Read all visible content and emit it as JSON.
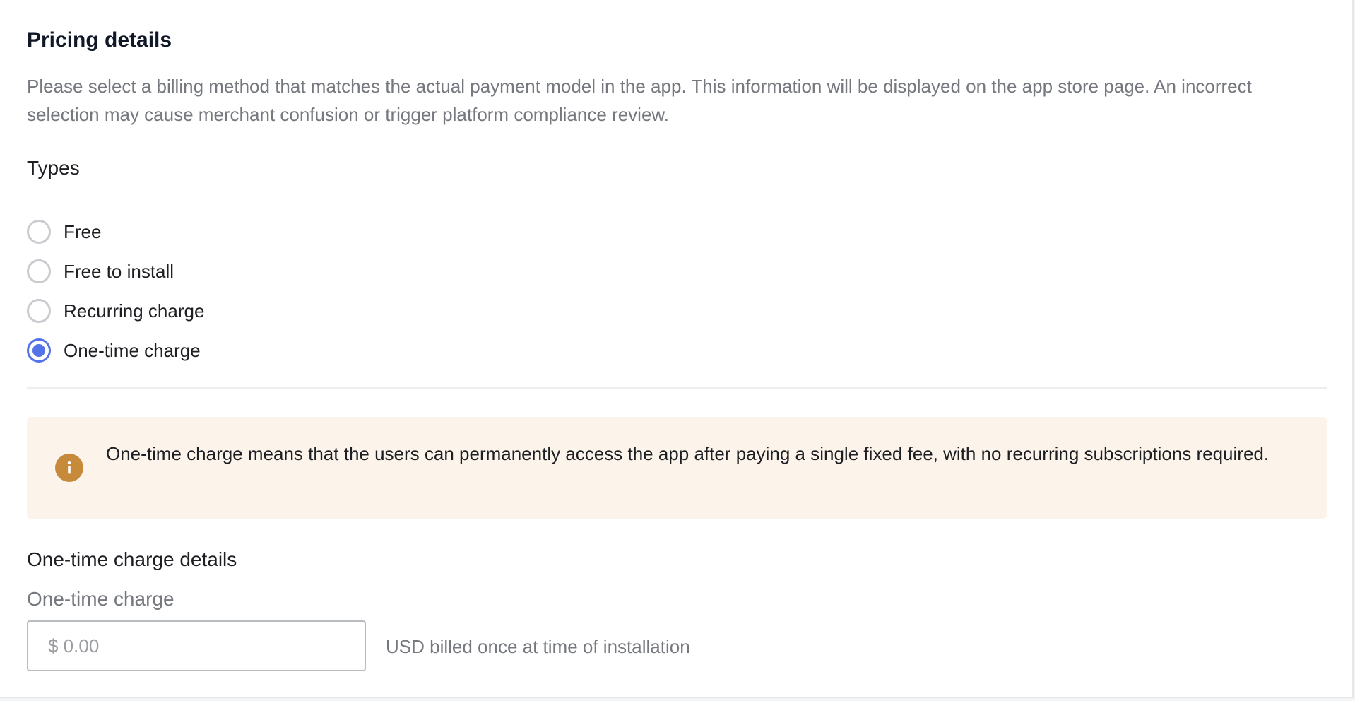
{
  "section": {
    "title": "Pricing details",
    "description": "Please select a billing method that matches the actual payment model in the app. This information will be displayed on the app store page. An incorrect selection may cause merchant confusion or trigger platform compliance review."
  },
  "types": {
    "label": "Types",
    "options": [
      {
        "label": "Free",
        "checked": false
      },
      {
        "label": "Free to install",
        "checked": false
      },
      {
        "label": "Recurring charge",
        "checked": false
      },
      {
        "label": "One-time charge",
        "checked": true
      }
    ],
    "selected": "One-time charge"
  },
  "notice": {
    "icon": "info-icon",
    "text": "One-time charge means that the users can permanently access the app after paying a single fixed fee, with no recurring subscriptions required."
  },
  "details": {
    "heading": "One-time charge details",
    "field_label": "One-time charge",
    "placeholder": "$ 0.00",
    "value": "",
    "suffix": "USD billed once at time of installation"
  },
  "colors": {
    "accent": "#5473e8",
    "notice_bg": "#fcf3ea",
    "info_icon": "#c78a3b"
  }
}
